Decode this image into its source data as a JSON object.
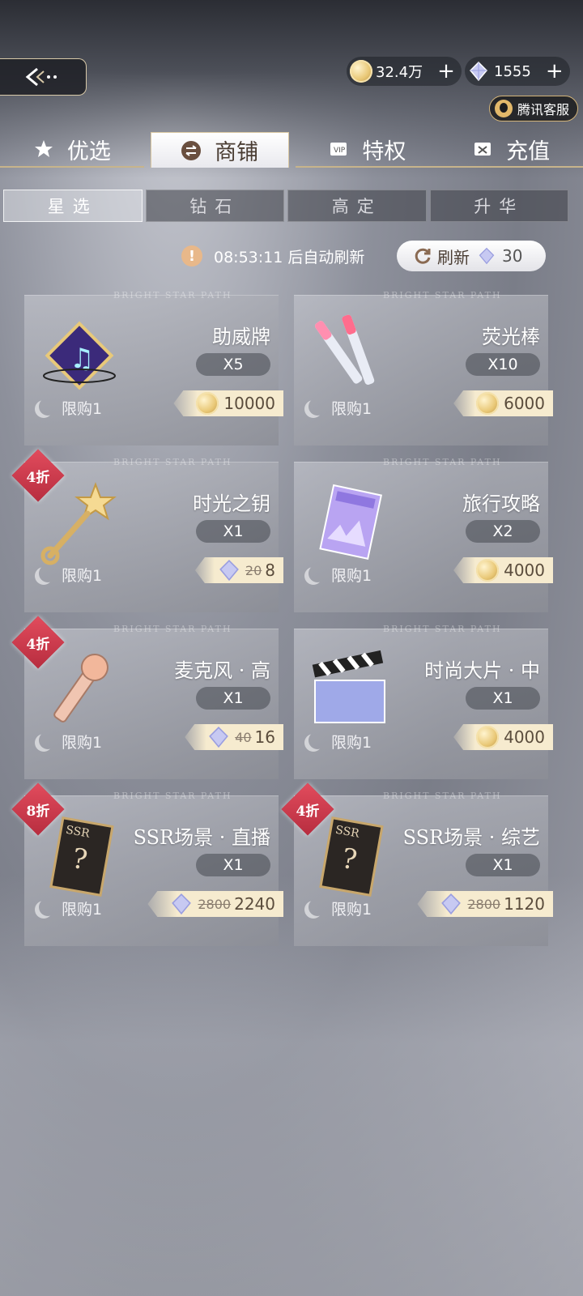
{
  "topbar": {
    "coins": "32.4万",
    "gems": "1555",
    "plus": "+",
    "service_label": "腾讯客服"
  },
  "main_tabs": [
    {
      "label": "优选",
      "icon": "star-icon"
    },
    {
      "label": "商铺",
      "icon": "exchange-icon",
      "active": true
    },
    {
      "label": "特权",
      "icon": "privilege-card-icon"
    },
    {
      "label": "充值",
      "icon": "recharge-icon"
    }
  ],
  "sub_tabs": [
    "星选",
    "钻石",
    "高定",
    "升华"
  ],
  "refresh": {
    "timer": "08:53:11 后自动刷新",
    "button_label": "刷新",
    "cost": "30"
  },
  "watermark": "BRIGHT STAR PATH",
  "items": [
    {
      "name": "助威牌",
      "qty": "X5",
      "limit": "限购1",
      "currency": "coin",
      "price": "10000",
      "old_price": "",
      "discount": ""
    },
    {
      "name": "荧光棒",
      "qty": "X10",
      "limit": "限购1",
      "currency": "coin",
      "price": "6000",
      "old_price": "",
      "discount": ""
    },
    {
      "name": "时光之钥",
      "qty": "X1",
      "limit": "限购1",
      "currency": "gem",
      "price": "8",
      "old_price": "20",
      "discount": "4折"
    },
    {
      "name": "旅行攻略",
      "qty": "X2",
      "limit": "限购1",
      "currency": "coin",
      "price": "4000",
      "old_price": "",
      "discount": ""
    },
    {
      "name": "麦克风 · 高",
      "qty": "X1",
      "limit": "限购1",
      "currency": "gem",
      "price": "16",
      "old_price": "40",
      "discount": "4折"
    },
    {
      "name": "时尚大片 · 中",
      "qty": "X1",
      "limit": "限购1",
      "currency": "coin",
      "price": "4000",
      "old_price": "",
      "discount": ""
    },
    {
      "name": "SSR场景 · 直播",
      "qty": "X1",
      "limit": "限购1",
      "currency": "gem",
      "price": "2240",
      "old_price": "2800",
      "discount": "8折"
    },
    {
      "name": "SSR场景 · 综艺",
      "qty": "X1",
      "limit": "限购1",
      "currency": "gem",
      "price": "1120",
      "old_price": "2800",
      "discount": "4折"
    }
  ],
  "colors": {
    "discount_badge": "#c9384a",
    "price_tag": "#f6ebcf",
    "gold_border": "#c7b48b"
  }
}
